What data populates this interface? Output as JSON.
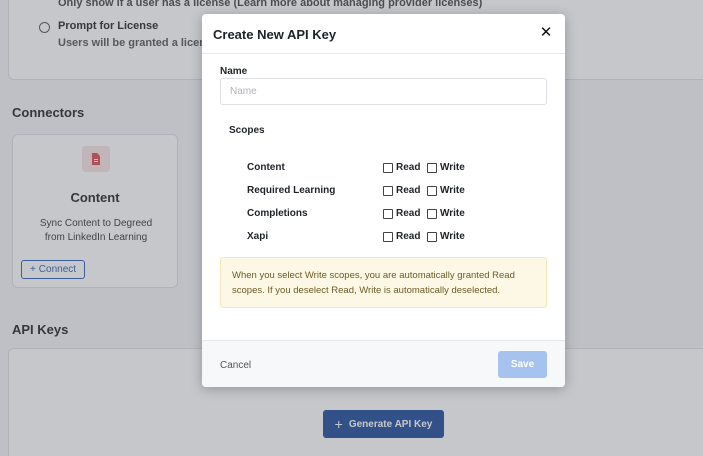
{
  "background": {
    "license_hint": "Only show if a user has a license (Learn more about managing provider licenses)",
    "prompt_option_title": "Prompt for License",
    "prompt_option_subtitle": "Users will be granted a license after",
    "connectors_title": "Connectors",
    "connector": {
      "title": "Content",
      "description": "Sync Content to Degreed from LinkedIn Learning",
      "connect_label": "Connect",
      "icon": "document-icon",
      "icon_color": "#e04b4b"
    },
    "api_keys_title": "API Keys",
    "generate_label": "Generate API Key"
  },
  "modal": {
    "title": "Create New API Key",
    "close_icon": "close-icon",
    "name_label": "Name",
    "name_placeholder": "Name",
    "name_value": "",
    "scopes_label": "Scopes",
    "scopes": [
      {
        "name": "Content",
        "read_label": "Read",
        "write_label": "Write",
        "read": false,
        "write": false
      },
      {
        "name": "Required Learning",
        "read_label": "Read",
        "write_label": "Write",
        "read": false,
        "write": false
      },
      {
        "name": "Completions",
        "read_label": "Read",
        "write_label": "Write",
        "read": false,
        "write": false
      },
      {
        "name": "Xapi",
        "read_label": "Read",
        "write_label": "Write",
        "read": false,
        "write": false
      }
    ],
    "info_text": "When you select Write scopes, you are automatically granted Read scopes. If you deselect Read, Write is automatically deselected.",
    "cancel_label": "Cancel",
    "save_label": "Save"
  },
  "colors": {
    "primary": "#1f4b9a",
    "save_disabled": "#a6c2ee",
    "info_bg": "#fdf8e6",
    "info_text": "#6b5b24"
  }
}
